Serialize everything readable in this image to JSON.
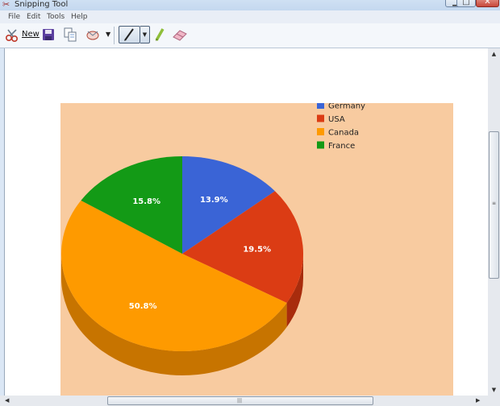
{
  "window": {
    "title": "Snipping Tool",
    "controls": {
      "minimize": "▁",
      "maximize": "□",
      "close": "✕"
    }
  },
  "menu": [
    "File",
    "Edit",
    "Tools",
    "Help"
  ],
  "toolbar": {
    "new_label": "New",
    "icons": [
      "scissors-icon",
      "save-icon",
      "copy-icon",
      "send-snip-icon",
      "pen-icon",
      "highlighter-icon",
      "eraser-icon"
    ],
    "dropdown_glyph": "▼"
  },
  "scrollbars": {
    "up": "▲",
    "down": "▼",
    "left": "◀",
    "right": "▶",
    "grip": "|||"
  },
  "chart_data": {
    "type": "pie",
    "style": "3d",
    "legend_position": "top-right",
    "slices": [
      {
        "label": "Germany",
        "value": 13.9,
        "display": "13.9%",
        "color": "#3a64d6",
        "side": "#2a4aa0"
      },
      {
        "label": "USA",
        "value": 19.5,
        "display": "19.5%",
        "color": "#db3c14",
        "side": "#a82c0d"
      },
      {
        "label": "Canada",
        "value": 50.8,
        "display": "50.8%",
        "color": "#fe9a00",
        "side": "#c77400"
      },
      {
        "label": "France",
        "value": 15.8,
        "display": "15.8%",
        "color": "#139a16",
        "side": "#0c6f0f"
      }
    ],
    "background": "#f8cba0",
    "label_color": "#ffffff"
  }
}
